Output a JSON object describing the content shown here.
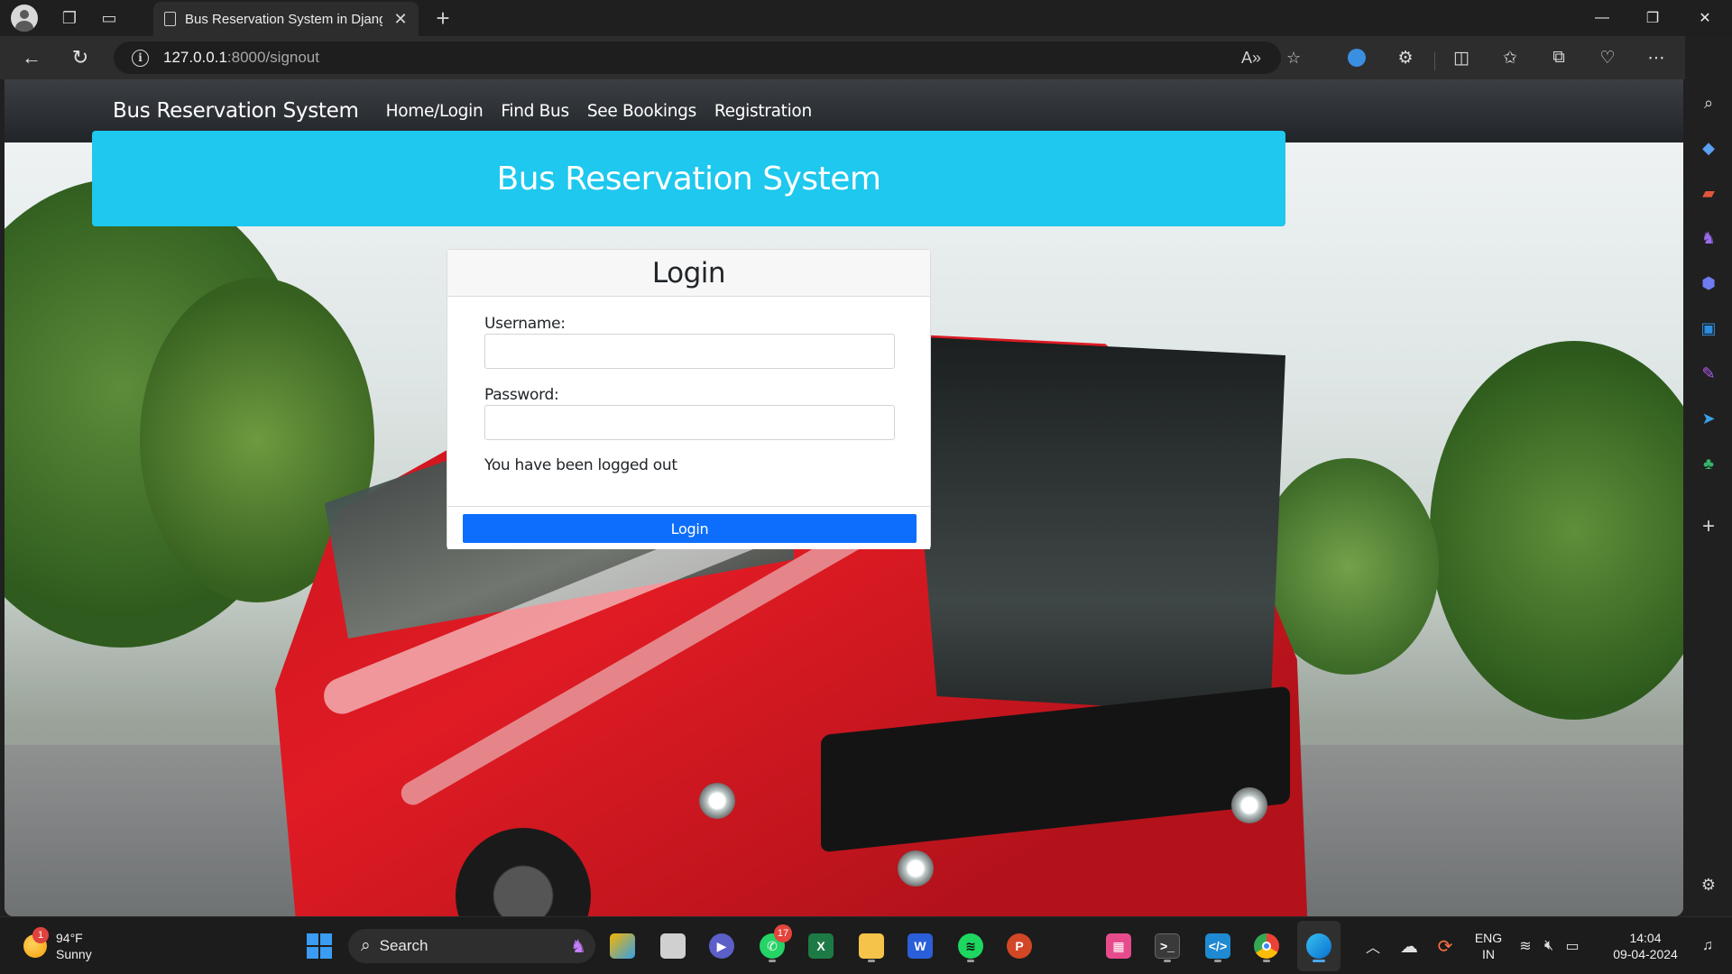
{
  "browser": {
    "tab_title": "Bus Reservation System in Djang",
    "url_host": "127.0.0.1",
    "url_path": ":8000/signout"
  },
  "site": {
    "brand": "Bus Reservation System",
    "nav_links": [
      "Home/Login",
      "Find Bus",
      "See Bookings",
      "Registration"
    ],
    "banner_title": "Bus Reservation System"
  },
  "login": {
    "title": "Login",
    "username_label": "Username:",
    "username_value": "",
    "password_label": "Password:",
    "password_value": "",
    "message": "You have been logged out",
    "submit_label": "Login"
  },
  "taskbar": {
    "weather_temp": "94°F",
    "weather_desc": "Sunny",
    "weather_badge": "1",
    "search_placeholder": "Search",
    "whatsapp_badge": "17",
    "language_line1": "ENG",
    "language_line2": "IN",
    "time": "14:04",
    "date": "09-04-2024"
  },
  "colors": {
    "banner": "#1ec8ee",
    "primary_button": "#0d6efd",
    "navbar": "#212529"
  }
}
